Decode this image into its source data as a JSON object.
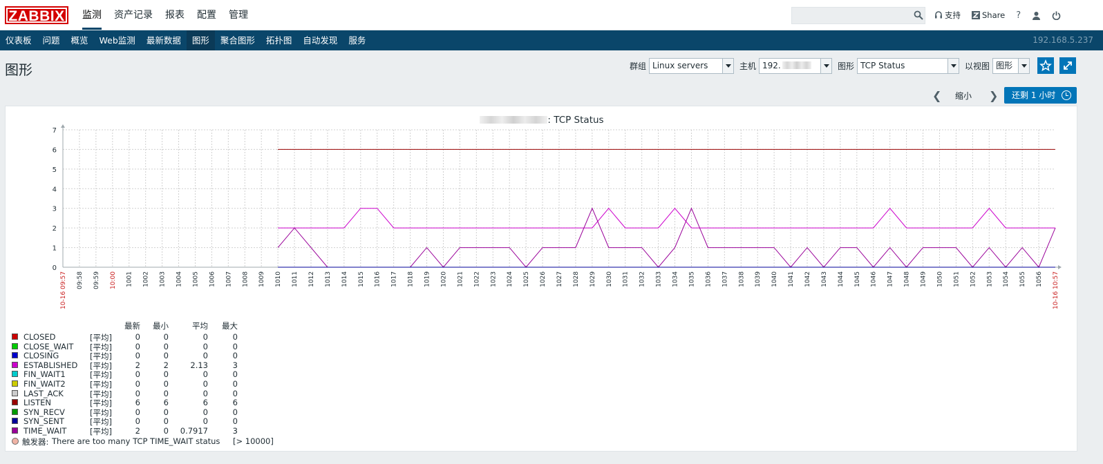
{
  "app": {
    "logo": "ZABBIX",
    "top_menu": [
      "监测",
      "资产记录",
      "报表",
      "配置",
      "管理"
    ],
    "top_links": [
      {
        "icon": "headset-icon",
        "label": "支持"
      },
      {
        "icon": "zabbix-share-icon",
        "label": "Share"
      },
      {
        "icon": "help-icon",
        "label": "?"
      },
      {
        "icon": "user-icon",
        "label": ""
      },
      {
        "icon": "power-icon",
        "label": ""
      }
    ],
    "sub_menu": [
      "仪表板",
      "问题",
      "概览",
      "Web监测",
      "最新数据",
      "图形",
      "聚合图形",
      "拓扑图",
      "自动发现",
      "服务"
    ],
    "sub_active": "图形",
    "server_ip": "192.168.5.237"
  },
  "page": {
    "title": "图形",
    "filters": {
      "group_label": "群组",
      "group_value": "Linux servers",
      "host_label": "主机",
      "host_value": "192.",
      "graph_label": "图形",
      "graph_value": "TCP Status",
      "view_label": "以视图",
      "view_value": "图形"
    },
    "time": {
      "zoom_label": "缩小",
      "range_button": "还剩 1 小时"
    }
  },
  "graph": {
    "title_suffix": ": TCP Status",
    "trigger": {
      "label": "触发器:",
      "text": "There are too many TCP TIME_WAIT status",
      "threshold": "[> 10000]"
    },
    "legend_headers": [
      "最新",
      "最小",
      "平均",
      "最大"
    ],
    "legend": [
      {
        "name": "CLOSED",
        "func": "[平均]",
        "last": "0",
        "min": "0",
        "avg": "0",
        "max": "0",
        "color": "#cc0000"
      },
      {
        "name": "CLOSE_WAIT",
        "func": "[平均]",
        "last": "0",
        "min": "0",
        "avg": "0",
        "max": "0",
        "color": "#00cc00"
      },
      {
        "name": "CLOSING",
        "func": "[平均]",
        "last": "0",
        "min": "0",
        "avg": "0",
        "max": "0",
        "color": "#0000cc"
      },
      {
        "name": "ESTABLISHED",
        "func": "[平均]",
        "last": "2",
        "min": "2",
        "avg": "2.13",
        "max": "3",
        "color": "#cc00cc"
      },
      {
        "name": "FIN_WAIT1",
        "func": "[平均]",
        "last": "0",
        "min": "0",
        "avg": "0",
        "max": "0",
        "color": "#00cccc"
      },
      {
        "name": "FIN_WAIT2",
        "func": "[平均]",
        "last": "0",
        "min": "0",
        "avg": "0",
        "max": "0",
        "color": "#cccc00"
      },
      {
        "name": "LAST_ACK",
        "func": "[平均]",
        "last": "0",
        "min": "0",
        "avg": "0",
        "max": "0",
        "color": "#cccccc"
      },
      {
        "name": "LISTEN",
        "func": "[平均]",
        "last": "6",
        "min": "6",
        "avg": "6",
        "max": "6",
        "color": "#990000"
      },
      {
        "name": "SYN_RECV",
        "func": "[平均]",
        "last": "0",
        "min": "0",
        "avg": "0",
        "max": "0",
        "color": "#009900"
      },
      {
        "name": "SYN_SENT",
        "func": "[平均]",
        "last": "0",
        "min": "0",
        "avg": "0",
        "max": "0",
        "color": "#000099"
      },
      {
        "name": "TIME_WAIT",
        "func": "[平均]",
        "last": "2",
        "min": "0",
        "avg": "0.7917",
        "max": "3",
        "color": "#990099"
      }
    ]
  },
  "chart_data": {
    "type": "line",
    "title": ": TCP Status",
    "ylim": [
      0,
      7
    ],
    "y_ticks": [
      "0",
      "1",
      "2",
      "3",
      "4",
      "5",
      "6",
      "7"
    ],
    "x_start_label": "10-16 09:57",
    "x_end_label": "10-16 10:57",
    "x_ticks": [
      "09:58",
      "09:59",
      "10:00",
      "10:01",
      "10:02",
      "10:03",
      "10:04",
      "10:05",
      "10:06",
      "10:07",
      "10:08",
      "10:09",
      "10:10",
      "10:11",
      "10:12",
      "10:13",
      "10:14",
      "10:15",
      "10:16",
      "10:17",
      "10:18",
      "10:19",
      "10:20",
      "10:21",
      "10:22",
      "10:23",
      "10:24",
      "10:25",
      "10:26",
      "10:27",
      "10:28",
      "10:29",
      "10:30",
      "10:31",
      "10:32",
      "10:33",
      "10:34",
      "10:35",
      "10:36",
      "10:37",
      "10:38",
      "10:39",
      "10:40",
      "10:41",
      "10:42",
      "10:43",
      "10:44",
      "10:45",
      "10:46",
      "10:47",
      "10:48",
      "10:49",
      "10:50",
      "10:51",
      "10:52",
      "10:53",
      "10:54",
      "10:55",
      "10:56"
    ],
    "x_tick_labels": [
      "09:58",
      "09:59",
      "10:00",
      "1001",
      "1002",
      "1003",
      "1004",
      "1005",
      "1006",
      "1007",
      "1008",
      "1009",
      "1010",
      "1011",
      "1012",
      "1013",
      "1014",
      "1015",
      "1016",
      "1017",
      "1018",
      "1019",
      "1020",
      "1021",
      "1022",
      "1023",
      "1024",
      "1025",
      "1026",
      "1027",
      "1028",
      "1029",
      "1030",
      "1031",
      "1032",
      "1033",
      "1034",
      "1035",
      "1036",
      "1037",
      "1038",
      "1039",
      "1040",
      "1041",
      "1042",
      "1043",
      "1044",
      "1045",
      "1046",
      "1047",
      "1048",
      "1049",
      "1050",
      "1051",
      "1052",
      "1053",
      "1054",
      "1055",
      "1056"
    ],
    "red_ticks": [
      "10:00"
    ],
    "series": [
      {
        "name": "LISTEN",
        "color": "#990000",
        "x": [
          "10:10",
          "10:57"
        ],
        "y": [
          6,
          6
        ]
      },
      {
        "name": "ESTABLISHED",
        "color": "#cc00cc",
        "x": [
          "10:10",
          "10:11",
          "10:12",
          "10:13",
          "10:14",
          "10:15",
          "10:16",
          "10:17",
          "10:18",
          "10:19",
          "10:20",
          "10:21",
          "10:22",
          "10:23",
          "10:24",
          "10:25",
          "10:26",
          "10:27",
          "10:28",
          "10:29",
          "10:30",
          "10:31",
          "10:32",
          "10:33",
          "10:34",
          "10:35",
          "10:36",
          "10:37",
          "10:38",
          "10:39",
          "10:40",
          "10:41",
          "10:42",
          "10:43",
          "10:44",
          "10:45",
          "10:46",
          "10:47",
          "10:48",
          "10:49",
          "10:50",
          "10:51",
          "10:52",
          "10:53",
          "10:54",
          "10:55",
          "10:56",
          "10:57"
        ],
        "y": [
          2,
          2,
          2,
          2,
          2,
          3,
          3,
          2,
          2,
          2,
          2,
          2,
          2,
          2,
          2,
          2,
          2,
          2,
          2,
          2,
          3,
          2,
          2,
          2,
          3,
          2,
          2,
          2,
          2,
          2,
          2,
          2,
          2,
          2,
          2,
          2,
          2,
          3,
          2,
          2,
          2,
          2,
          2,
          3,
          2,
          2,
          2,
          2
        ]
      },
      {
        "name": "TIME_WAIT",
        "color": "#990099",
        "x": [
          "10:10",
          "10:11",
          "10:12",
          "10:13",
          "10:14",
          "10:15",
          "10:16",
          "10:17",
          "10:18",
          "10:19",
          "10:20",
          "10:21",
          "10:22",
          "10:23",
          "10:24",
          "10:25",
          "10:26",
          "10:27",
          "10:28",
          "10:29",
          "10:30",
          "10:31",
          "10:32",
          "10:33",
          "10:34",
          "10:35",
          "10:36",
          "10:37",
          "10:38",
          "10:39",
          "10:40",
          "10:41",
          "10:42",
          "10:43",
          "10:44",
          "10:45",
          "10:46",
          "10:47",
          "10:48",
          "10:49",
          "10:50",
          "10:51",
          "10:52",
          "10:53",
          "10:54",
          "10:55",
          "10:56",
          "10:57"
        ],
        "y": [
          1,
          2,
          1,
          0,
          0,
          0,
          0,
          0,
          0,
          1,
          0,
          1,
          1,
          1,
          1,
          0,
          1,
          1,
          1,
          3,
          1,
          1,
          1,
          0,
          1,
          3,
          1,
          1,
          1,
          1,
          1,
          0,
          1,
          0,
          1,
          1,
          0,
          1,
          0,
          1,
          1,
          1,
          0,
          1,
          0,
          1,
          0,
          2
        ]
      },
      {
        "name": "SYN_SENT",
        "color": "#000099",
        "x": [
          "10:10",
          "10:57"
        ],
        "y": [
          0,
          0
        ]
      }
    ],
    "grid": true,
    "legend_position": "bottom-left"
  }
}
